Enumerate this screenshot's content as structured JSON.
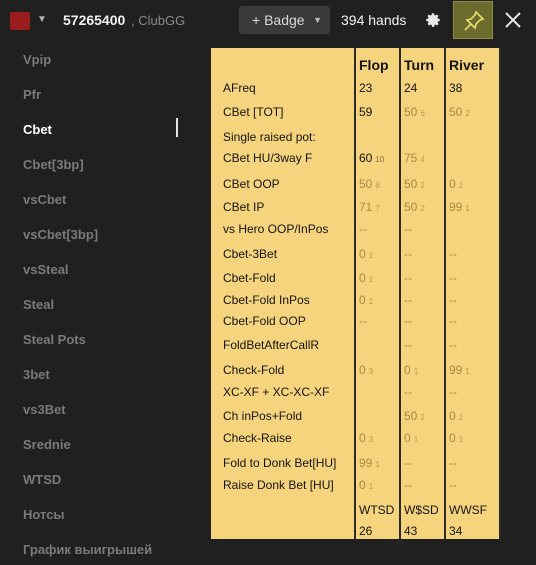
{
  "header": {
    "player_id": "57265400",
    "room": ", ClubGG",
    "badge_label": "+ Badge",
    "hands": "394 hands",
    "swatch_color": "#9a1d1d",
    "icons": [
      "chevron-down-icon",
      "gear-icon",
      "pin-icon",
      "close-icon"
    ]
  },
  "sidebar": {
    "items": [
      {
        "label": "Vpip",
        "active": false
      },
      {
        "label": "Pfr",
        "active": false
      },
      {
        "label": "Cbet",
        "active": true
      },
      {
        "label": "Cbet[3bp]",
        "active": false
      },
      {
        "label": "vsCbet",
        "active": false
      },
      {
        "label": "vsCbet[3bp]",
        "active": false
      },
      {
        "label": "vsSteal",
        "active": false
      },
      {
        "label": "Steal",
        "active": false
      },
      {
        "label": "Steal Pots",
        "active": false
      },
      {
        "label": "3bet",
        "active": false
      },
      {
        "label": "vs3Bet",
        "active": false
      },
      {
        "label": "Srednie",
        "active": false
      },
      {
        "label": "WTSD",
        "active": false
      },
      {
        "label": "Нотсы",
        "active": false
      },
      {
        "label": "График выигрышей",
        "active": false
      }
    ]
  },
  "stats": {
    "headers": [
      "Flop",
      "Turn",
      "River"
    ],
    "rows": [
      {
        "label": "AFreq",
        "cells": [
          {
            "v": "23",
            "s": ""
          },
          {
            "v": "24",
            "s": ""
          },
          {
            "v": "38",
            "s": ""
          }
        ],
        "dim": [
          false,
          false,
          false
        ]
      },
      {
        "label": "CBet [TOT]",
        "cells": [
          {
            "v": "59",
            "s": ""
          },
          {
            "v": "50",
            "s": "6"
          },
          {
            "v": "50",
            "s": "2"
          }
        ],
        "dim": [
          false,
          true,
          true
        ]
      },
      {
        "label": "Single raised pot:",
        "cells": [
          {
            "v": "",
            "s": ""
          },
          {
            "v": "",
            "s": ""
          },
          {
            "v": "",
            "s": ""
          }
        ],
        "dim": [
          false,
          false,
          false
        ]
      },
      {
        "label": "CBet HU/3way F",
        "cells": [
          {
            "v": "60",
            "s": "10"
          },
          {
            "v": "75",
            "s": "4"
          },
          {
            "v": "",
            "s": ""
          }
        ],
        "dim": [
          false,
          true,
          false
        ]
      },
      {
        "label": "CBet OOP",
        "cells": [
          {
            "v": "50",
            "s": "8"
          },
          {
            "v": "50",
            "s": "2"
          },
          {
            "v": "0",
            "s": "1"
          }
        ],
        "dim": [
          true,
          true,
          true
        ]
      },
      {
        "label": "CBet IP",
        "cells": [
          {
            "v": "71",
            "s": "7"
          },
          {
            "v": "50",
            "s": "2"
          },
          {
            "v": "99",
            "s": "1"
          }
        ],
        "dim": [
          true,
          true,
          true
        ]
      },
      {
        "label": "vs Hero OOP/InPos",
        "cells": [
          {
            "v": "--",
            "s": ""
          },
          {
            "v": "--",
            "s": ""
          },
          {
            "v": "",
            "s": ""
          }
        ],
        "dim": [
          true,
          true,
          false
        ]
      },
      {
        "label": "Cbet-3Bet",
        "cells": [
          {
            "v": "0",
            "s": "1"
          },
          {
            "v": "--",
            "s": ""
          },
          {
            "v": "--",
            "s": ""
          }
        ],
        "dim": [
          true,
          true,
          true
        ]
      },
      {
        "label": "Cbet-Fold",
        "cells": [
          {
            "v": "0",
            "s": "1"
          },
          {
            "v": "--",
            "s": ""
          },
          {
            "v": "--",
            "s": ""
          }
        ],
        "dim": [
          true,
          true,
          true
        ]
      },
      {
        "label": "Cbet-Fold InPos",
        "cells": [
          {
            "v": "0",
            "s": "1"
          },
          {
            "v": "--",
            "s": ""
          },
          {
            "v": "--",
            "s": ""
          }
        ],
        "dim": [
          true,
          true,
          true
        ]
      },
      {
        "label": "Cbet-Fold OOP",
        "cells": [
          {
            "v": "--",
            "s": ""
          },
          {
            "v": "--",
            "s": ""
          },
          {
            "v": "--",
            "s": ""
          }
        ],
        "dim": [
          true,
          true,
          true
        ]
      },
      {
        "label": "FoldBetAfterCallR",
        "cells": [
          {
            "v": "",
            "s": ""
          },
          {
            "v": "--",
            "s": ""
          },
          {
            "v": "--",
            "s": ""
          }
        ],
        "dim": [
          false,
          true,
          true
        ]
      },
      {
        "label": "Check-Fold",
        "cells": [
          {
            "v": "0",
            "s": "3"
          },
          {
            "v": "0",
            "s": "1"
          },
          {
            "v": "99",
            "s": "1"
          }
        ],
        "dim": [
          true,
          true,
          true
        ]
      },
      {
        "label": "XC-XF + XC-XC-XF",
        "cells": [
          {
            "v": "",
            "s": ""
          },
          {
            "v": "--",
            "s": ""
          },
          {
            "v": "--",
            "s": ""
          }
        ],
        "dim": [
          false,
          true,
          true
        ]
      },
      {
        "label": "Ch inPos+Fold",
        "cells": [
          {
            "v": "",
            "s": ""
          },
          {
            "v": "50",
            "s": "2"
          },
          {
            "v": "0",
            "s": "1"
          }
        ],
        "dim": [
          false,
          true,
          true
        ]
      },
      {
        "label": "Check-Raise",
        "cells": [
          {
            "v": "0",
            "s": "3"
          },
          {
            "v": "0",
            "s": "1"
          },
          {
            "v": "0",
            "s": "1"
          }
        ],
        "dim": [
          true,
          true,
          true
        ]
      },
      {
        "label": "Fold to Donk Bet[HU]",
        "cells": [
          {
            "v": "99",
            "s": "1"
          },
          {
            "v": "--",
            "s": ""
          },
          {
            "v": "--",
            "s": ""
          }
        ],
        "dim": [
          true,
          true,
          true
        ]
      },
      {
        "label": "Raise Donk Bet [HU]",
        "cells": [
          {
            "v": "0",
            "s": "1"
          },
          {
            "v": "--",
            "s": ""
          },
          {
            "v": "--",
            "s": ""
          }
        ],
        "dim": [
          true,
          true,
          true
        ]
      }
    ],
    "footer_headers": [
      "WTSD",
      "W$SD",
      "WWSF"
    ],
    "footer_values": [
      "26",
      "43",
      "34"
    ]
  }
}
